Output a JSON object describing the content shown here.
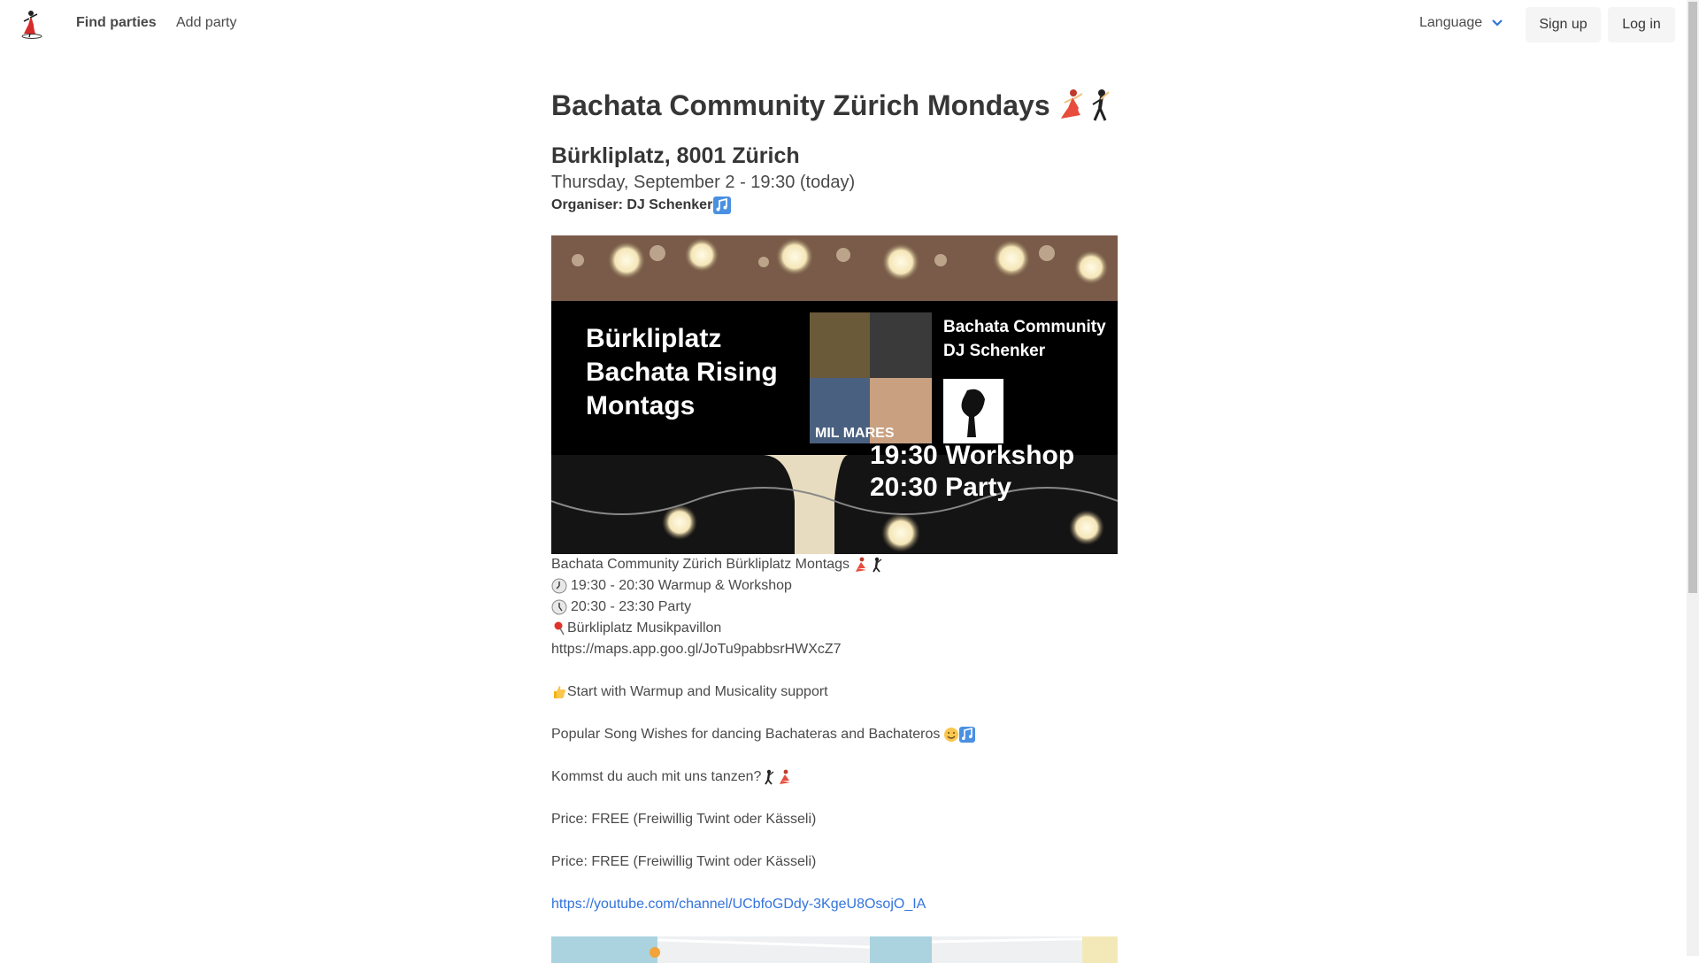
{
  "nav": {
    "find_parties": "Find parties",
    "add_party": "Add party",
    "language": "Language",
    "sign_up": "Sign up",
    "log_in": "Log in"
  },
  "event": {
    "title": "Bachata Community Zürich Mondays",
    "location": "Bürkliplatz, 8001 Zürich",
    "date": "Thursday, September 2 - 19:30 (today)",
    "organiser": "Organiser: DJ Schenker"
  },
  "poster": {
    "left_line1": "Bürkliplatz",
    "left_line2": "Bachata Rising",
    "left_line3": "Montags",
    "right_line1": "Bachata Community",
    "right_line2": "DJ Schenker",
    "time_line1": "19:30 Workshop",
    "time_line2": "20:30 Party",
    "album_text": "MIL MARES"
  },
  "description": {
    "line1": "Bachata Community Zürich Bürkliplatz Montags",
    "line2": "19:30 - 20:30 Warmup & Workshop",
    "line3": "20:30 - 23:30 Party",
    "line4": "Bürkliplatz Musikpavillon",
    "line5": "https://maps.app.goo.gl/JoTu9pabbsrHWXcZ7",
    "line6": "Start with Warmup and Musicality support",
    "line7": "Popular Song Wishes for dancing Bachateras and Bachateros",
    "line8": "Kommst du auch mit uns tanzen?",
    "line9": "Price: FREE (Freiwillig Twint oder Kässeli)",
    "line10": "Price: FREE (Freiwillig Twint oder Kässeli)",
    "youtube": "https://youtube.com/channel/UCbfoGDdy-3KgeU8OsojO_IA"
  },
  "colors": {
    "link": "#3273dc",
    "button_bg": "#f5f5f5",
    "text": "#4a4a4a"
  }
}
